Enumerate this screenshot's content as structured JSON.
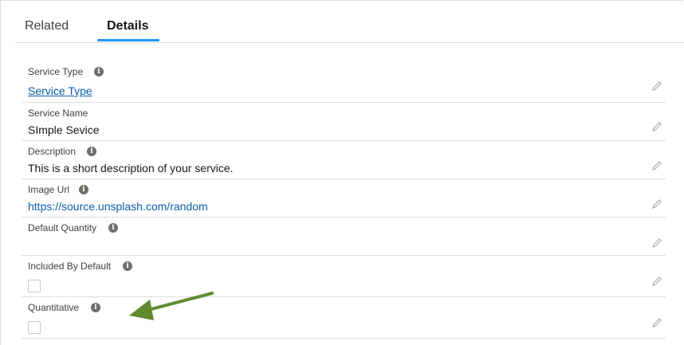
{
  "tabs": {
    "related": "Related",
    "details": "Details"
  },
  "fields": {
    "service_type": {
      "label": "Service Type",
      "value": "Service Type"
    },
    "service_name": {
      "label": "Service Name",
      "value": "SImple Sevice"
    },
    "description": {
      "label": "Description",
      "value": "This is a short description of your service."
    },
    "image_url": {
      "label": "Image Url",
      "value": "https://source.unsplash.com/random"
    },
    "default_quantity": {
      "label": "Default Quantity",
      "value": ""
    },
    "included_by_default": {
      "label": "Included By Default",
      "checked": false
    },
    "quantitative": {
      "label": "Quantitative",
      "checked": false
    }
  },
  "icons": {
    "info": "info-icon",
    "edit": "pencil-edit-icon",
    "annotation": "arrow-pointer"
  },
  "colors": {
    "link": "#0b5cab",
    "tab_accent": "#1b96ff",
    "annotation_arrow": "#5f8a2e"
  }
}
